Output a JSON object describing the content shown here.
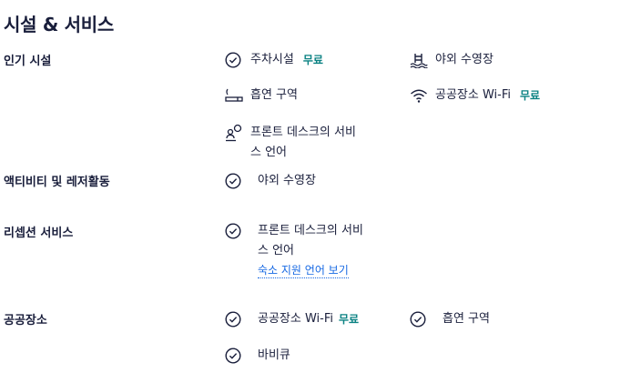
{
  "title": "시설 & 서비스",
  "free_label": "무료",
  "sections": {
    "popular": {
      "label": "인기 시설",
      "items": [
        {
          "label": "주차시설",
          "icon": "check-circle-icon",
          "free": true
        },
        {
          "label": "야외 수영장",
          "icon": "pool-icon",
          "free": false
        },
        {
          "label": "흡연 구역",
          "icon": "smoking-icon",
          "free": false
        },
        {
          "label": "공공장소 Wi-Fi",
          "icon": "wifi-icon",
          "free": true
        },
        {
          "label_line1": "프론트 데스크의 서비",
          "label_line2": "스 언어",
          "icon": "concierge-icon",
          "free": false
        }
      ]
    },
    "activities": {
      "label": "액티비티 및 레저활동",
      "items": [
        {
          "label": "야외 수영장",
          "icon": "check-circle-icon"
        }
      ]
    },
    "reception": {
      "label": "리셉션 서비스",
      "items": [
        {
          "label_line1": "프론트 데스크의 서비",
          "label_line2": "스 언어",
          "icon": "check-circle-icon"
        }
      ],
      "link": "숙소 지원 언어 보기"
    },
    "public": {
      "label": "공공장소",
      "items": [
        {
          "label": "공공장소 Wi-Fi",
          "icon": "check-circle-icon",
          "free": true
        },
        {
          "label": "흡연 구역",
          "icon": "check-circle-icon"
        },
        {
          "label": "바비큐",
          "icon": "check-circle-icon"
        }
      ]
    }
  },
  "colors": {
    "text": "#191e3b",
    "free": "#0b8283",
    "link": "#1668e3"
  }
}
